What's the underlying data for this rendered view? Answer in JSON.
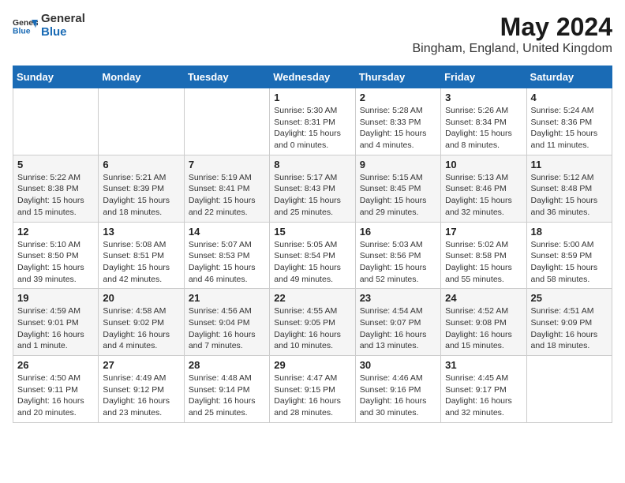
{
  "header": {
    "logo_general": "General",
    "logo_blue": "Blue",
    "main_title": "May 2024",
    "subtitle": "Bingham, England, United Kingdom"
  },
  "days_of_week": [
    "Sunday",
    "Monday",
    "Tuesday",
    "Wednesday",
    "Thursday",
    "Friday",
    "Saturday"
  ],
  "weeks": [
    [
      {
        "day": "",
        "info": ""
      },
      {
        "day": "",
        "info": ""
      },
      {
        "day": "",
        "info": ""
      },
      {
        "day": "1",
        "info": "Sunrise: 5:30 AM\nSunset: 8:31 PM\nDaylight: 15 hours\nand 0 minutes."
      },
      {
        "day": "2",
        "info": "Sunrise: 5:28 AM\nSunset: 8:33 PM\nDaylight: 15 hours\nand 4 minutes."
      },
      {
        "day": "3",
        "info": "Sunrise: 5:26 AM\nSunset: 8:34 PM\nDaylight: 15 hours\nand 8 minutes."
      },
      {
        "day": "4",
        "info": "Sunrise: 5:24 AM\nSunset: 8:36 PM\nDaylight: 15 hours\nand 11 minutes."
      }
    ],
    [
      {
        "day": "5",
        "info": "Sunrise: 5:22 AM\nSunset: 8:38 PM\nDaylight: 15 hours\nand 15 minutes."
      },
      {
        "day": "6",
        "info": "Sunrise: 5:21 AM\nSunset: 8:39 PM\nDaylight: 15 hours\nand 18 minutes."
      },
      {
        "day": "7",
        "info": "Sunrise: 5:19 AM\nSunset: 8:41 PM\nDaylight: 15 hours\nand 22 minutes."
      },
      {
        "day": "8",
        "info": "Sunrise: 5:17 AM\nSunset: 8:43 PM\nDaylight: 15 hours\nand 25 minutes."
      },
      {
        "day": "9",
        "info": "Sunrise: 5:15 AM\nSunset: 8:45 PM\nDaylight: 15 hours\nand 29 minutes."
      },
      {
        "day": "10",
        "info": "Sunrise: 5:13 AM\nSunset: 8:46 PM\nDaylight: 15 hours\nand 32 minutes."
      },
      {
        "day": "11",
        "info": "Sunrise: 5:12 AM\nSunset: 8:48 PM\nDaylight: 15 hours\nand 36 minutes."
      }
    ],
    [
      {
        "day": "12",
        "info": "Sunrise: 5:10 AM\nSunset: 8:50 PM\nDaylight: 15 hours\nand 39 minutes."
      },
      {
        "day": "13",
        "info": "Sunrise: 5:08 AM\nSunset: 8:51 PM\nDaylight: 15 hours\nand 42 minutes."
      },
      {
        "day": "14",
        "info": "Sunrise: 5:07 AM\nSunset: 8:53 PM\nDaylight: 15 hours\nand 46 minutes."
      },
      {
        "day": "15",
        "info": "Sunrise: 5:05 AM\nSunset: 8:54 PM\nDaylight: 15 hours\nand 49 minutes."
      },
      {
        "day": "16",
        "info": "Sunrise: 5:03 AM\nSunset: 8:56 PM\nDaylight: 15 hours\nand 52 minutes."
      },
      {
        "day": "17",
        "info": "Sunrise: 5:02 AM\nSunset: 8:58 PM\nDaylight: 15 hours\nand 55 minutes."
      },
      {
        "day": "18",
        "info": "Sunrise: 5:00 AM\nSunset: 8:59 PM\nDaylight: 15 hours\nand 58 minutes."
      }
    ],
    [
      {
        "day": "19",
        "info": "Sunrise: 4:59 AM\nSunset: 9:01 PM\nDaylight: 16 hours\nand 1 minute."
      },
      {
        "day": "20",
        "info": "Sunrise: 4:58 AM\nSunset: 9:02 PM\nDaylight: 16 hours\nand 4 minutes."
      },
      {
        "day": "21",
        "info": "Sunrise: 4:56 AM\nSunset: 9:04 PM\nDaylight: 16 hours\nand 7 minutes."
      },
      {
        "day": "22",
        "info": "Sunrise: 4:55 AM\nSunset: 9:05 PM\nDaylight: 16 hours\nand 10 minutes."
      },
      {
        "day": "23",
        "info": "Sunrise: 4:54 AM\nSunset: 9:07 PM\nDaylight: 16 hours\nand 13 minutes."
      },
      {
        "day": "24",
        "info": "Sunrise: 4:52 AM\nSunset: 9:08 PM\nDaylight: 16 hours\nand 15 minutes."
      },
      {
        "day": "25",
        "info": "Sunrise: 4:51 AM\nSunset: 9:09 PM\nDaylight: 16 hours\nand 18 minutes."
      }
    ],
    [
      {
        "day": "26",
        "info": "Sunrise: 4:50 AM\nSunset: 9:11 PM\nDaylight: 16 hours\nand 20 minutes."
      },
      {
        "day": "27",
        "info": "Sunrise: 4:49 AM\nSunset: 9:12 PM\nDaylight: 16 hours\nand 23 minutes."
      },
      {
        "day": "28",
        "info": "Sunrise: 4:48 AM\nSunset: 9:14 PM\nDaylight: 16 hours\nand 25 minutes."
      },
      {
        "day": "29",
        "info": "Sunrise: 4:47 AM\nSunset: 9:15 PM\nDaylight: 16 hours\nand 28 minutes."
      },
      {
        "day": "30",
        "info": "Sunrise: 4:46 AM\nSunset: 9:16 PM\nDaylight: 16 hours\nand 30 minutes."
      },
      {
        "day": "31",
        "info": "Sunrise: 4:45 AM\nSunset: 9:17 PM\nDaylight: 16 hours\nand 32 minutes."
      },
      {
        "day": "",
        "info": ""
      }
    ]
  ]
}
